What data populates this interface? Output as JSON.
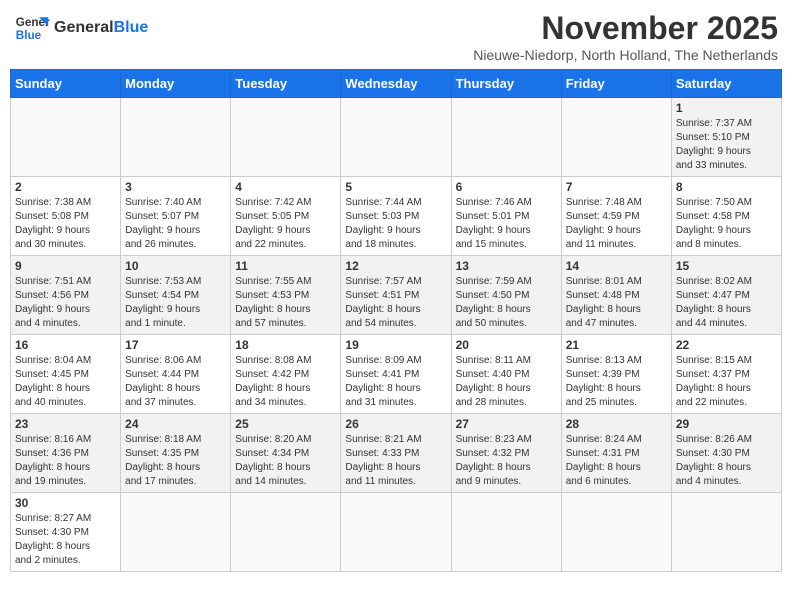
{
  "header": {
    "logo_general": "General",
    "logo_blue": "Blue",
    "title": "November 2025",
    "subtitle": "Nieuwe-Niedorp, North Holland, The Netherlands"
  },
  "weekdays": [
    "Sunday",
    "Monday",
    "Tuesday",
    "Wednesday",
    "Thursday",
    "Friday",
    "Saturday"
  ],
  "weeks": [
    [
      {
        "day": "",
        "info": ""
      },
      {
        "day": "",
        "info": ""
      },
      {
        "day": "",
        "info": ""
      },
      {
        "day": "",
        "info": ""
      },
      {
        "day": "",
        "info": ""
      },
      {
        "day": "",
        "info": ""
      },
      {
        "day": "1",
        "info": "Sunrise: 7:37 AM\nSunset: 5:10 PM\nDaylight: 9 hours\nand 33 minutes."
      }
    ],
    [
      {
        "day": "2",
        "info": "Sunrise: 7:38 AM\nSunset: 5:08 PM\nDaylight: 9 hours\nand 30 minutes."
      },
      {
        "day": "3",
        "info": "Sunrise: 7:40 AM\nSunset: 5:07 PM\nDaylight: 9 hours\nand 26 minutes."
      },
      {
        "day": "4",
        "info": "Sunrise: 7:42 AM\nSunset: 5:05 PM\nDaylight: 9 hours\nand 22 minutes."
      },
      {
        "day": "5",
        "info": "Sunrise: 7:44 AM\nSunset: 5:03 PM\nDaylight: 9 hours\nand 18 minutes."
      },
      {
        "day": "6",
        "info": "Sunrise: 7:46 AM\nSunset: 5:01 PM\nDaylight: 9 hours\nand 15 minutes."
      },
      {
        "day": "7",
        "info": "Sunrise: 7:48 AM\nSunset: 4:59 PM\nDaylight: 9 hours\nand 11 minutes."
      },
      {
        "day": "8",
        "info": "Sunrise: 7:50 AM\nSunset: 4:58 PM\nDaylight: 9 hours\nand 8 minutes."
      }
    ],
    [
      {
        "day": "9",
        "info": "Sunrise: 7:51 AM\nSunset: 4:56 PM\nDaylight: 9 hours\nand 4 minutes."
      },
      {
        "day": "10",
        "info": "Sunrise: 7:53 AM\nSunset: 4:54 PM\nDaylight: 9 hours\nand 1 minute."
      },
      {
        "day": "11",
        "info": "Sunrise: 7:55 AM\nSunset: 4:53 PM\nDaylight: 8 hours\nand 57 minutes."
      },
      {
        "day": "12",
        "info": "Sunrise: 7:57 AM\nSunset: 4:51 PM\nDaylight: 8 hours\nand 54 minutes."
      },
      {
        "day": "13",
        "info": "Sunrise: 7:59 AM\nSunset: 4:50 PM\nDaylight: 8 hours\nand 50 minutes."
      },
      {
        "day": "14",
        "info": "Sunrise: 8:01 AM\nSunset: 4:48 PM\nDaylight: 8 hours\nand 47 minutes."
      },
      {
        "day": "15",
        "info": "Sunrise: 8:02 AM\nSunset: 4:47 PM\nDaylight: 8 hours\nand 44 minutes."
      }
    ],
    [
      {
        "day": "16",
        "info": "Sunrise: 8:04 AM\nSunset: 4:45 PM\nDaylight: 8 hours\nand 40 minutes."
      },
      {
        "day": "17",
        "info": "Sunrise: 8:06 AM\nSunset: 4:44 PM\nDaylight: 8 hours\nand 37 minutes."
      },
      {
        "day": "18",
        "info": "Sunrise: 8:08 AM\nSunset: 4:42 PM\nDaylight: 8 hours\nand 34 minutes."
      },
      {
        "day": "19",
        "info": "Sunrise: 8:09 AM\nSunset: 4:41 PM\nDaylight: 8 hours\nand 31 minutes."
      },
      {
        "day": "20",
        "info": "Sunrise: 8:11 AM\nSunset: 4:40 PM\nDaylight: 8 hours\nand 28 minutes."
      },
      {
        "day": "21",
        "info": "Sunrise: 8:13 AM\nSunset: 4:39 PM\nDaylight: 8 hours\nand 25 minutes."
      },
      {
        "day": "22",
        "info": "Sunrise: 8:15 AM\nSunset: 4:37 PM\nDaylight: 8 hours\nand 22 minutes."
      }
    ],
    [
      {
        "day": "23",
        "info": "Sunrise: 8:16 AM\nSunset: 4:36 PM\nDaylight: 8 hours\nand 19 minutes."
      },
      {
        "day": "24",
        "info": "Sunrise: 8:18 AM\nSunset: 4:35 PM\nDaylight: 8 hours\nand 17 minutes."
      },
      {
        "day": "25",
        "info": "Sunrise: 8:20 AM\nSunset: 4:34 PM\nDaylight: 8 hours\nand 14 minutes."
      },
      {
        "day": "26",
        "info": "Sunrise: 8:21 AM\nSunset: 4:33 PM\nDaylight: 8 hours\nand 11 minutes."
      },
      {
        "day": "27",
        "info": "Sunrise: 8:23 AM\nSunset: 4:32 PM\nDaylight: 8 hours\nand 9 minutes."
      },
      {
        "day": "28",
        "info": "Sunrise: 8:24 AM\nSunset: 4:31 PM\nDaylight: 8 hours\nand 6 minutes."
      },
      {
        "day": "29",
        "info": "Sunrise: 8:26 AM\nSunset: 4:30 PM\nDaylight: 8 hours\nand 4 minutes."
      }
    ],
    [
      {
        "day": "30",
        "info": "Sunrise: 8:27 AM\nSunset: 4:30 PM\nDaylight: 8 hours\nand 2 minutes."
      },
      {
        "day": "",
        "info": ""
      },
      {
        "day": "",
        "info": ""
      },
      {
        "day": "",
        "info": ""
      },
      {
        "day": "",
        "info": ""
      },
      {
        "day": "",
        "info": ""
      },
      {
        "day": "",
        "info": ""
      }
    ]
  ]
}
